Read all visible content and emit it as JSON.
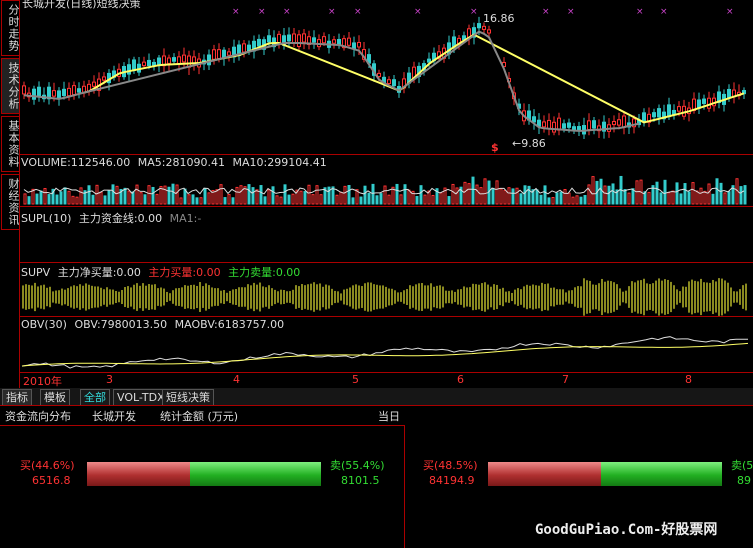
{
  "chart_title": "长城开发(日线)短线决策",
  "side_tabs": [
    "分时走势",
    "技术分析",
    "基本资料",
    "财经资讯"
  ],
  "price_chart": {
    "high_label": "16.86",
    "low_label": "←9.86",
    "signal_marker": "$"
  },
  "volume_panel": {
    "name": "VOLUME:112546.00",
    "ma5": "MA5:281090.41",
    "ma10": "MA10:299104.41"
  },
  "supl_panel": {
    "name": "SUPL(10)",
    "main_line": "主力资金线:0.00",
    "ma1": "MA1:-"
  },
  "supv_panel": {
    "name": "SUPV",
    "net_buy": "主力净买量:0.00",
    "buy": "主力买量:0.00",
    "sell": "主力卖量:0.00"
  },
  "obv_panel": {
    "name": "OBV(30)",
    "obv": "OBV:7980013.50",
    "maobv": "MAOBV:6183757.00"
  },
  "date_axis": [
    "2010年",
    "3",
    "4",
    "5",
    "6",
    "7",
    "8"
  ],
  "bottom_tabs": [
    "指标",
    "模板",
    "全部",
    "VOL-TDX",
    "短线决策"
  ],
  "flow": {
    "title": "资金流向分布",
    "stock": "长城开发",
    "unit": "统计金额 (万元)",
    "period": "当日",
    "left": {
      "buy_label": "买(44.6%)",
      "buy_value": "6516.8",
      "sell_label": "卖(55.4%)",
      "sell_value": "8101.5"
    },
    "right": {
      "buy_label": "买(48.5%)",
      "buy_value": "84194.9",
      "sell_label": "卖(5",
      "sell_value": "89"
    }
  },
  "watermark": "GoodGuPiao.Com-好股票网",
  "colors": {
    "up": "#ff3333",
    "down": "#33cccc",
    "ma_yellow": "#ffff66",
    "ma_gray": "#888888",
    "olive": "#8a8a20",
    "border": "#aa0000",
    "green_text": "#33dd33",
    "red_text": "#ff3333"
  }
}
